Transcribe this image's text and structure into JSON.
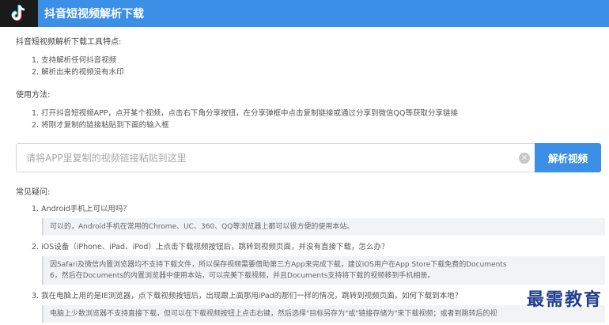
{
  "header": {
    "title": "抖音短视频解析下载",
    "logo_icon": "tiktok-logo-icon",
    "color": "#3c8fe6"
  },
  "features": {
    "title": "抖音短视频解析下载工具特点:",
    "items": [
      "1. 支持解析任何抖音视频",
      "2. 解析出来的视频没有水印"
    ]
  },
  "usage": {
    "title": "使用方法:",
    "items": [
      "1. 打开抖音短视频APP，点开某个视频，点击右下角分享按钮，在分享弹框中点击复制链接或通过分享到微信QQ等获取分享链接",
      "2. 将刚才复制的链接粘贴到下面的输入框"
    ]
  },
  "search": {
    "placeholder": "请将APP里复制的视频链接粘贴到这里",
    "value": "",
    "clear_icon": "clear-icon",
    "button_label": "解析视频"
  },
  "faq": {
    "title": "常见疑问:",
    "items": [
      {
        "q": "1. Android手机上可以用吗？",
        "a": [
          "可以的，Android手机在常用的Chrome、UC、360、QQ等浏览器上都可以很方便的使用本站。"
        ]
      },
      {
        "q": "2. iOS设备（iPhone、iPad、iPod）上点击下载视频按钮后，跳转到视频页面，并没有直接下载，怎么办？",
        "a": [
          "因Safari及微信内置浏览器均不支持下载文件，所以保存视频需要借助第三方App来完成下载，建议iOS用户在App Store下载免费的Documents",
          "6，然后在Documents的内置浏览器中使用本站，可以完美下载视频，并且Documents支持将下载的视频移到手机相册。"
        ]
      },
      {
        "q": "3. 我在电脑上用的是IE浏览器，点下载视频按钮后，出现跟上面那用iPad的那们一样的情况，跳转到视频页面，如何下载到本地？",
        "a": [
          "电脑上少数浏览器不支持直接下载，但可以在下载视频按钮上点击右键，然后选择\"目标另存为\"或\"链接存储为\"来下载视频；或者到跳转后的视"
        ]
      }
    ]
  },
  "watermark": "最需教育"
}
